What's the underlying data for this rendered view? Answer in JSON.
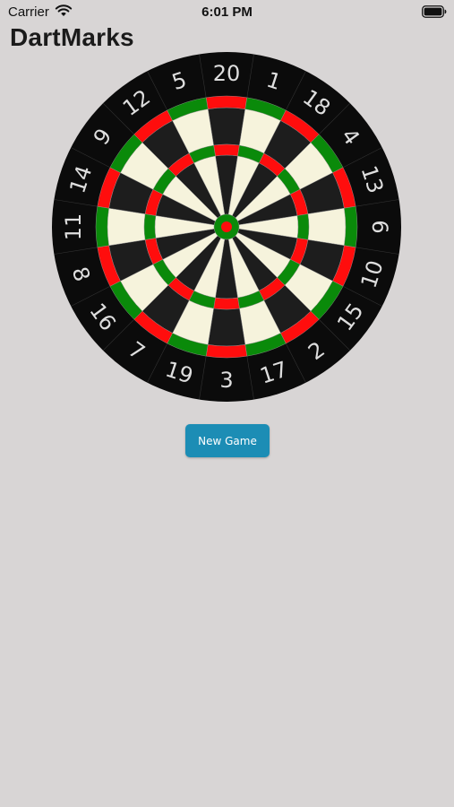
{
  "status_bar": {
    "carrier": "Carrier",
    "time": "6:01 PM",
    "wifi_icon": "wifi-icon",
    "battery_icon": "battery-icon"
  },
  "app": {
    "title": "DartMarks"
  },
  "dartboard": {
    "numbers": [
      "20",
      "1",
      "18",
      "4",
      "13",
      "6",
      "10",
      "15",
      "2",
      "17",
      "3",
      "19",
      "7",
      "16",
      "8",
      "11",
      "14",
      "9",
      "12",
      "5"
    ],
    "colors": {
      "outer": "#0b0b0b",
      "dark_segment": "#1d1d1d",
      "light_segment": "#f6f3dc",
      "red_ring": "#ff0d0d",
      "green_ring": "#0a8a0a",
      "number_text": "#dedede"
    }
  },
  "actions": {
    "new_game_label": "New Game"
  },
  "colors": {
    "background": "#d8d5d5",
    "button": "#1c8db5"
  }
}
